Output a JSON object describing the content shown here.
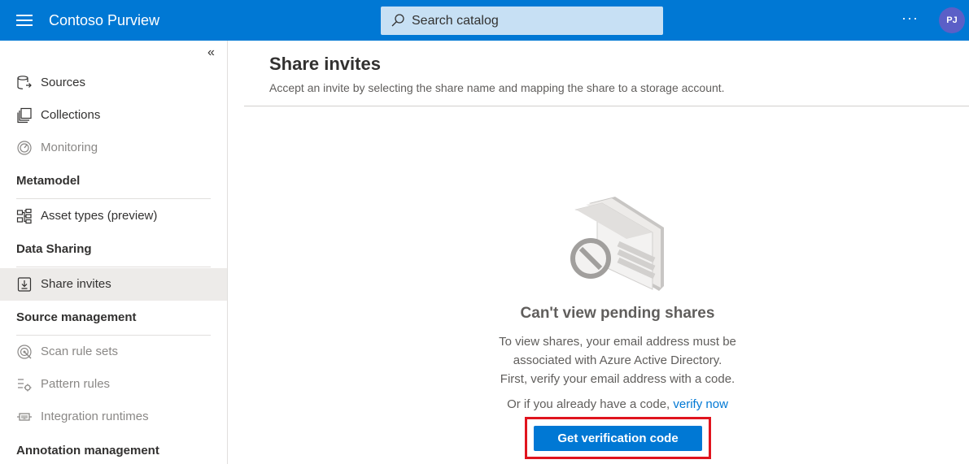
{
  "header": {
    "app_title": "Contoso Purview",
    "search_placeholder": "Search catalog",
    "more_label": "···",
    "avatar_initials": "PJ",
    "brand_color": "#0078d4"
  },
  "sidebar": {
    "collapse_label": "«",
    "items": [
      {
        "label": "Sources",
        "icon": "sources-icon",
        "disabled": false
      },
      {
        "label": "Collections",
        "icon": "collections-icon",
        "disabled": false
      },
      {
        "label": "Monitoring",
        "icon": "monitoring-icon",
        "disabled": true
      }
    ],
    "sections": {
      "metamodel": {
        "title": "Metamodel",
        "items": [
          {
            "label": "Asset types (preview)",
            "icon": "asset-types-icon"
          }
        ]
      },
      "data_sharing": {
        "title": "Data Sharing",
        "items": [
          {
            "label": "Share invites",
            "icon": "share-invites-icon",
            "active": true
          }
        ]
      },
      "source_management": {
        "title": "Source management",
        "items": [
          {
            "label": "Scan rule sets",
            "icon": "scan-rule-sets-icon",
            "disabled": true
          },
          {
            "label": "Pattern rules",
            "icon": "pattern-rules-icon",
            "disabled": true
          },
          {
            "label": "Integration runtimes",
            "icon": "integration-runtimes-icon",
            "disabled": true
          }
        ]
      },
      "annotation_management": {
        "title": "Annotation management"
      }
    }
  },
  "main": {
    "title": "Share invites",
    "subtitle": "Accept an invite by selecting the share name and mapping the share to a storage account.",
    "empty_state": {
      "title": "Can't view pending shares",
      "lines": [
        "To view shares, your email address must be",
        "associated with Azure Active Directory.",
        "First, verify your email address with a code."
      ],
      "or_text": "Or if you already have a code, ",
      "verify_link": "verify now",
      "button_label": "Get verification code"
    }
  }
}
